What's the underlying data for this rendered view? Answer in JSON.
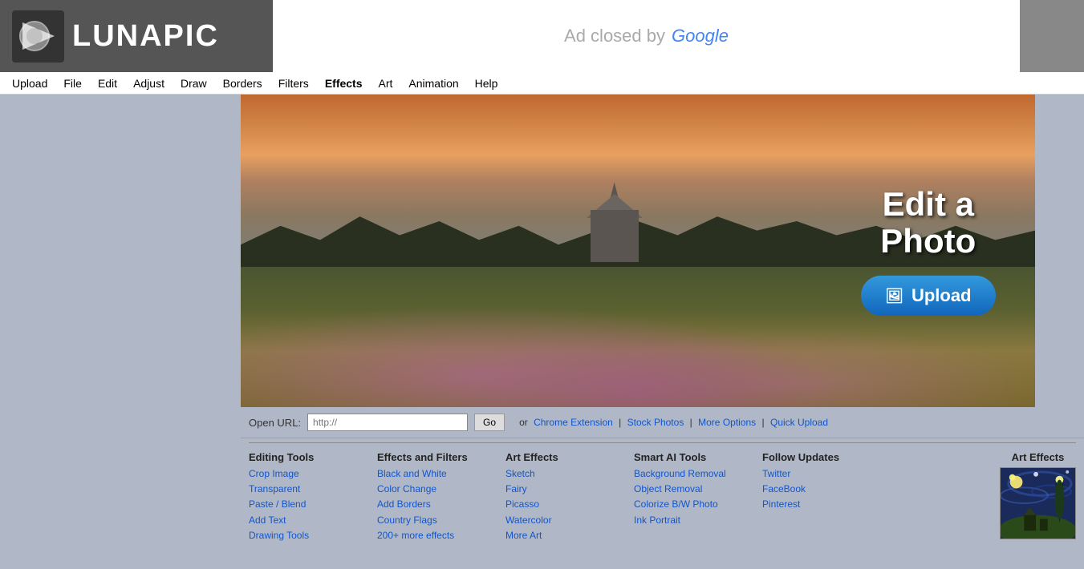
{
  "header": {
    "logo_text": "LUNAPIC",
    "ad_text": "Ad closed by",
    "ad_google": "Google"
  },
  "navbar": {
    "items": [
      {
        "label": "Upload",
        "id": "upload"
      },
      {
        "label": "File",
        "id": "file"
      },
      {
        "label": "Edit",
        "id": "edit"
      },
      {
        "label": "Adjust",
        "id": "adjust"
      },
      {
        "label": "Draw",
        "id": "draw"
      },
      {
        "label": "Borders",
        "id": "borders"
      },
      {
        "label": "Filters",
        "id": "filters"
      },
      {
        "label": "Effects",
        "id": "effects"
      },
      {
        "label": "Art",
        "id": "art"
      },
      {
        "label": "Animation",
        "id": "animation"
      },
      {
        "label": "Help",
        "id": "help"
      }
    ]
  },
  "hero": {
    "title_line1": "Edit a",
    "title_line2": "Photo",
    "upload_btn": "Upload"
  },
  "url_bar": {
    "label": "Open URL:",
    "placeholder": "http://",
    "go_btn": "Go",
    "separator": "or",
    "chrome_link": "Chrome Extension",
    "pipe1": "|",
    "stock_link": "Stock Photos",
    "pipe2": "|",
    "options_link": "More Options",
    "pipe3": "|",
    "quick_link": "Quick Upload"
  },
  "footer": {
    "cols": [
      {
        "title": "Editing Tools",
        "links": [
          "Crop Image",
          "Transparent",
          "Paste / Blend",
          "Add Text",
          "Drawing Tools"
        ]
      },
      {
        "title": "Effects and Filters",
        "links": [
          "Black and White",
          "Color Change",
          "Add Borders",
          "Country Flags",
          "200+ more effects"
        ]
      },
      {
        "title": "Art Effects",
        "links": [
          "Sketch",
          "Fairy",
          "Picasso",
          "Watercolor",
          "More Art"
        ]
      },
      {
        "title": "Smart AI Tools",
        "links": [
          "Background Removal",
          "Object Removal",
          "Colorize B/W Photo",
          "Ink Portrait"
        ]
      },
      {
        "title": "Follow Updates",
        "links": [
          "Twitter",
          "FaceBook",
          "Pinterest"
        ]
      }
    ],
    "art_effects_thumb_title": "Art Effects"
  }
}
